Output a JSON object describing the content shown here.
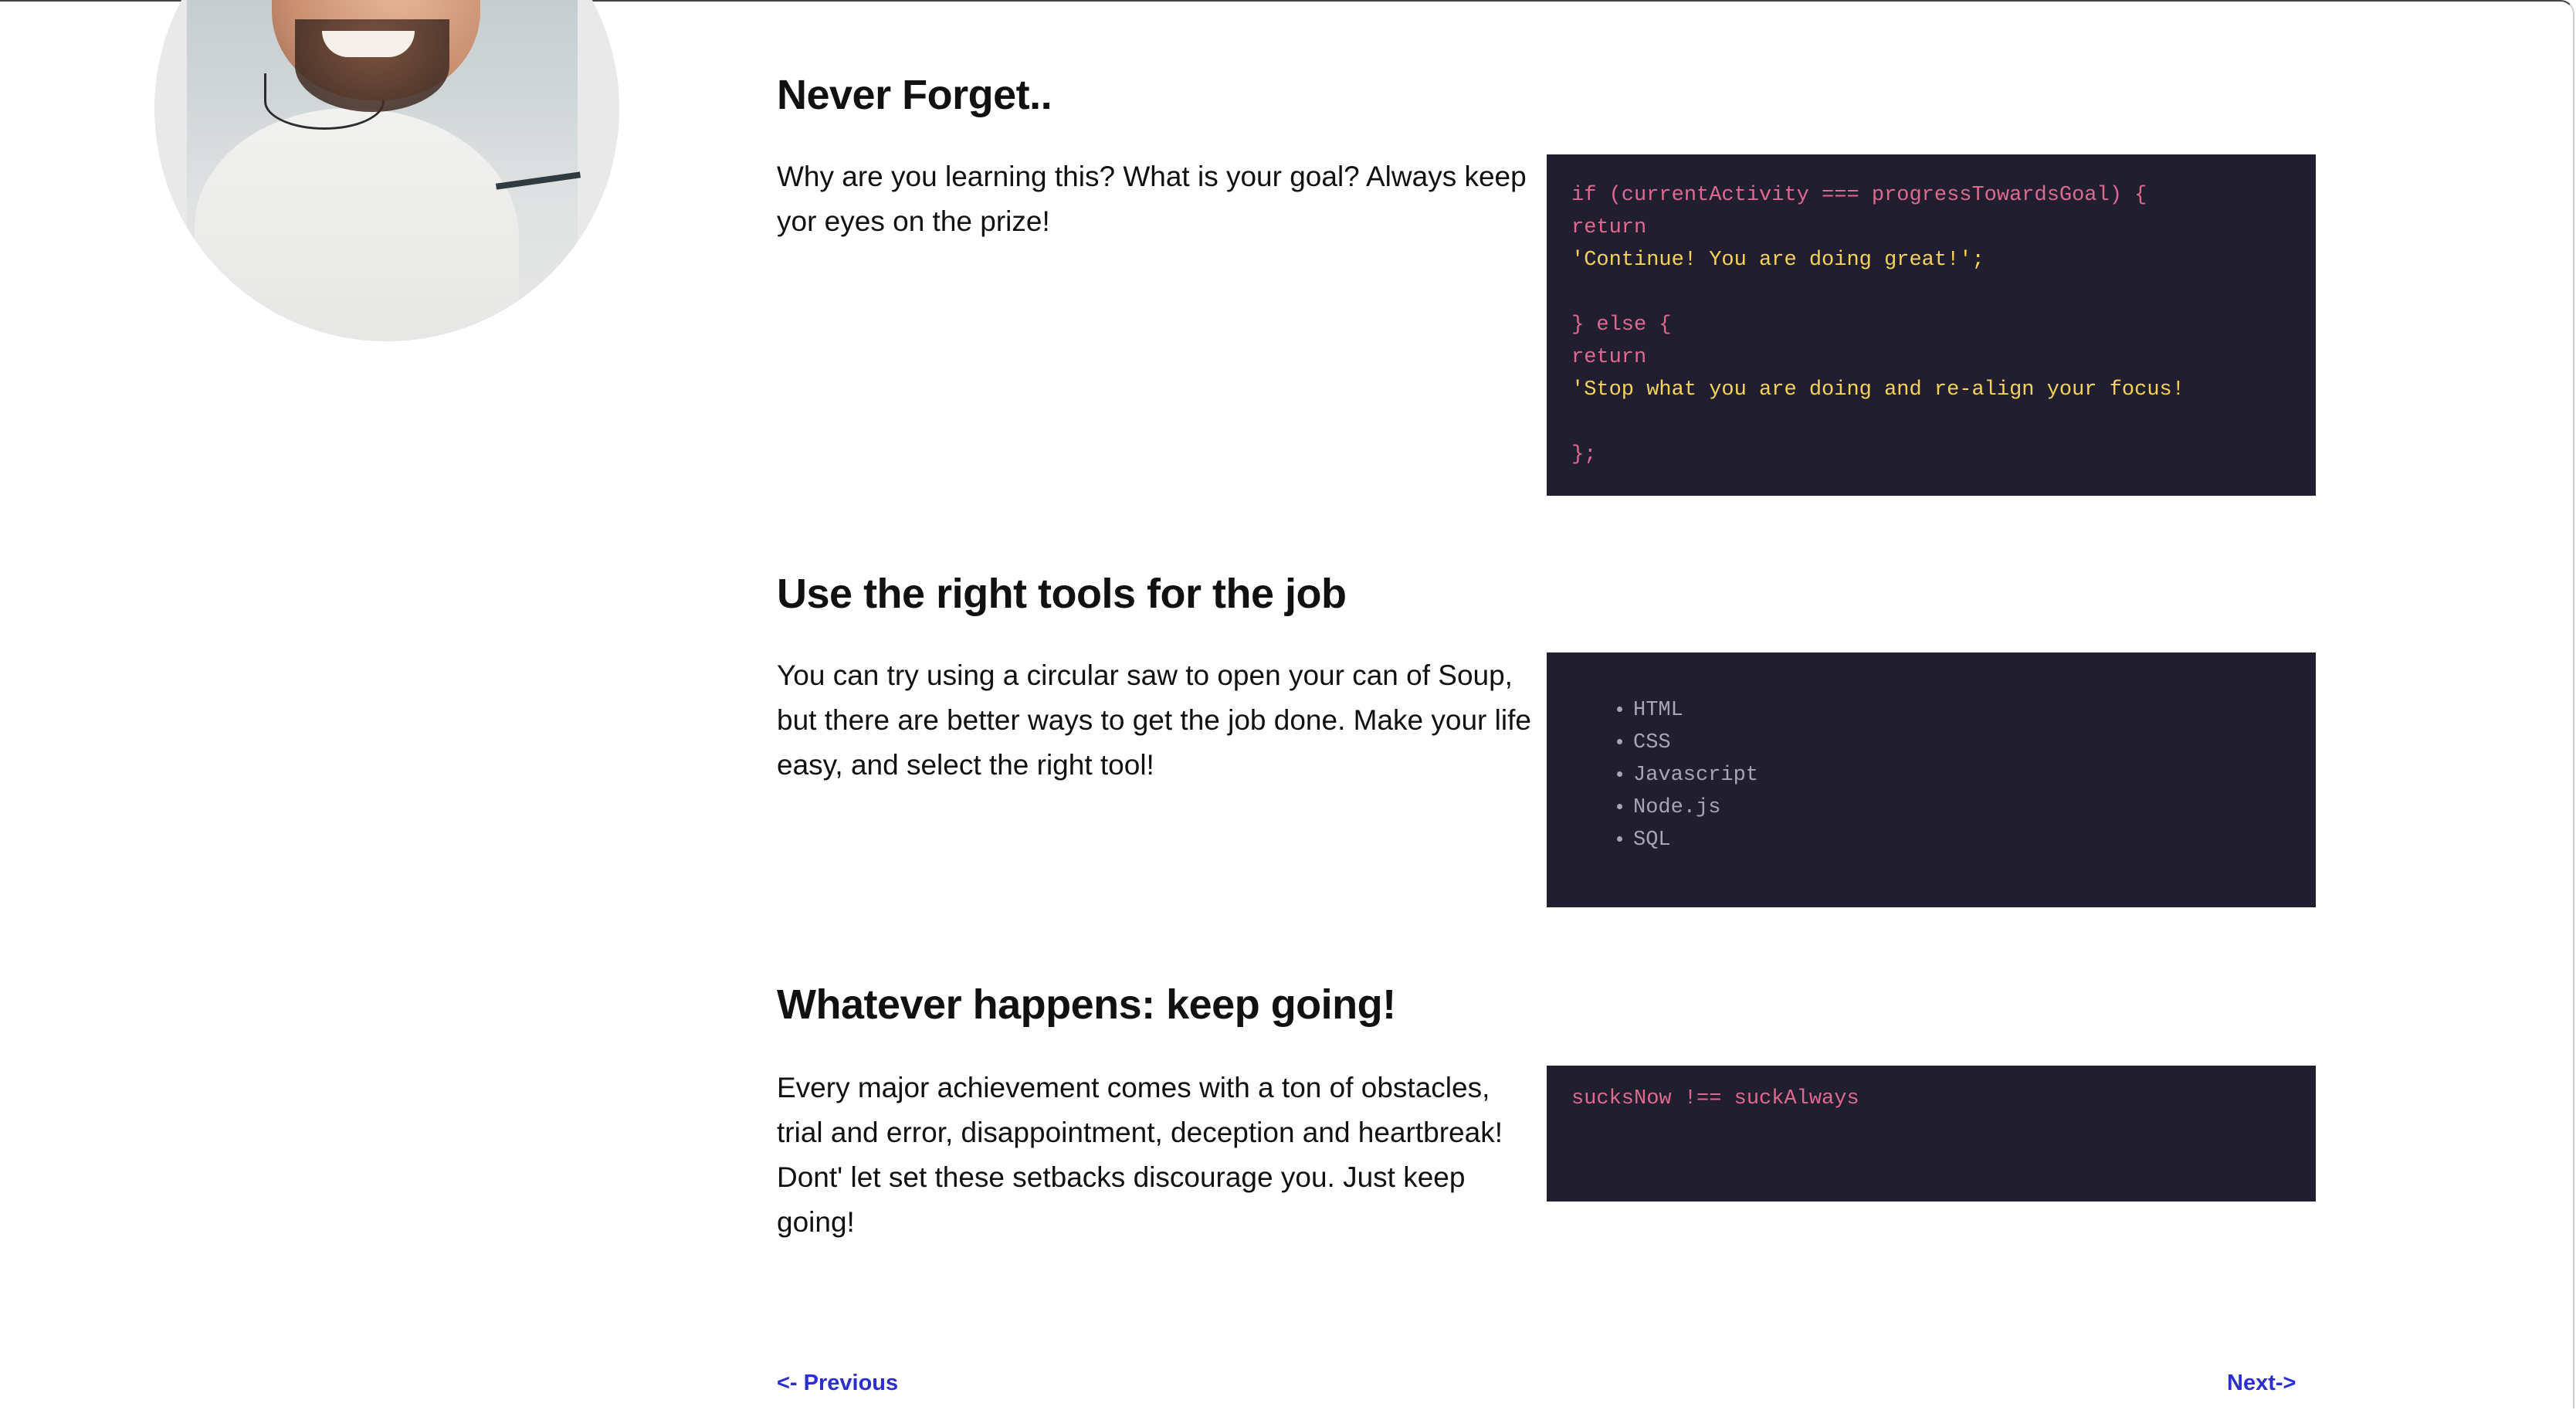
{
  "sections": [
    {
      "heading": "Never Forget..",
      "text": "Why are you learning this? What is your goal? Always keep yor eyes on the prize!",
      "code_lines": [
        {
          "text": "if (currentActivity === progressTowardsGoal) {",
          "color": "#e06a8f"
        },
        {
          "text": "return",
          "color": "#e06a8f"
        },
        {
          "text": "'Continue! You are doing great!';",
          "color": "#f6d35a"
        },
        {
          "text": "",
          "color": "#e06a8f"
        },
        {
          "text": "} else {",
          "color": "#e06a8f"
        },
        {
          "text": "return",
          "color": "#e06a8f"
        },
        {
          "text": "'Stop what you are doing and re-align your focus!",
          "color": "#f6d35a"
        },
        {
          "text": "",
          "color": "#e06a8f"
        },
        {
          "text": "};",
          "color": "#e06a8f"
        }
      ]
    },
    {
      "heading": "Use the right tools for the job",
      "text": "You can try using a circular saw to open your can of Soup, but there are better ways to get the job done. Make your life easy, and select the right tool!",
      "tools": [
        "HTML",
        "CSS",
        "Javascript",
        "Node.js",
        "SQL"
      ]
    },
    {
      "heading": "Whatever happens: keep going!",
      "text": "Every major achievement comes with a ton of obstacles, trial and error, disappointment, deception and heartbreak! Dont' let set these setbacks discourage you. Just keep going!",
      "code_lines": [
        {
          "text": "sucksNow !== suckAlways",
          "color": "#e06a8f"
        }
      ]
    }
  ],
  "nav": {
    "previous": "<- Previous",
    "next": "Next->"
  },
  "colors": {
    "code_background": "#211f2f",
    "code_keyword": "#e06a8f",
    "code_string": "#f6d35a",
    "code_list": "#a8a6b3",
    "link": "#2c2fd0"
  }
}
